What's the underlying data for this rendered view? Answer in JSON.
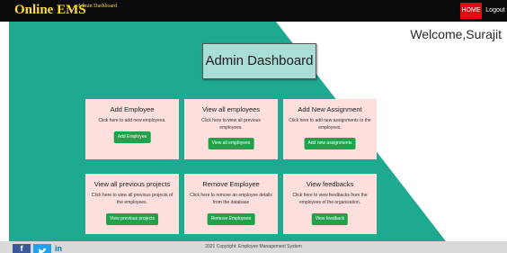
{
  "header": {
    "brand": "Online EMS",
    "subtitle": "Admin Dashboard",
    "nav": {
      "home": "HOME",
      "logout": "Logout"
    }
  },
  "welcome": "Welcome,Surajit",
  "page_title": "Admin Dashboard",
  "cards": [
    {
      "title": "Add Employee",
      "description": "Click here to add new employees.",
      "button": "Add Employee"
    },
    {
      "title": "View all employees",
      "description": "Click here to view all previous employees.",
      "button": "View all employees"
    },
    {
      "title": "Add New Assignment",
      "description": "Click here to add new assignments to the employees.",
      "button": "Add new assignments"
    },
    {
      "title": "View all previous projects",
      "description": "Click here to view all previous projects of the employees.",
      "button": "View previous projects"
    },
    {
      "title": "Remove Employee",
      "description": "Click here to remove an employee details from the database",
      "button": "Remove Employees"
    },
    {
      "title": "View feedbacks",
      "description": "Click here to view feedbacks from the employees of the organisation.",
      "button": "View feedback"
    }
  ],
  "footer": {
    "copyright": "2021 Copyright: Employee Management System",
    "social_icons": [
      "facebook-icon",
      "twitter-icon",
      "linkedin-icon"
    ]
  },
  "colors": {
    "teal": "#1ea991",
    "card_bg": "#fde0dd",
    "button_green": "#21a14a",
    "home_red": "#e30613",
    "brand_yellow": "#ffd83a",
    "topbar": "#0b0b0b"
  }
}
